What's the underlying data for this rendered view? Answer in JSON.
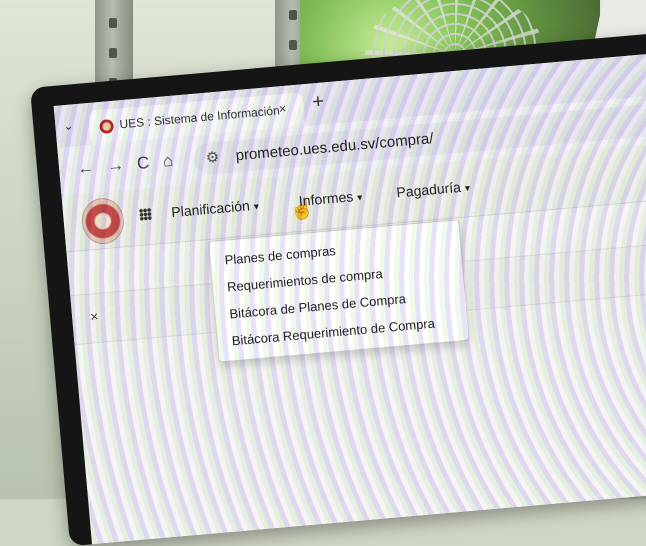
{
  "browser": {
    "tab_dropdown_icon": "chevron-down-icon",
    "tab_title": "UES : Sistema de Información",
    "tab_close_glyph": "×",
    "new_tab_glyph": "+",
    "url": "prometeo.ues.edu.sv/compra/"
  },
  "navbar": {
    "menus": [
      {
        "label": "Planificación"
      },
      {
        "label": "Informes"
      },
      {
        "label": "Pagaduría"
      }
    ],
    "caret_glyph": "▾"
  },
  "dropdown": {
    "items": [
      "Planes de compras",
      "Requerimientos de compra",
      "Bitácora de Planes de Compra",
      "Bitácora Requerimiento de Compra"
    ]
  },
  "content": {
    "close_glyph": "×"
  }
}
